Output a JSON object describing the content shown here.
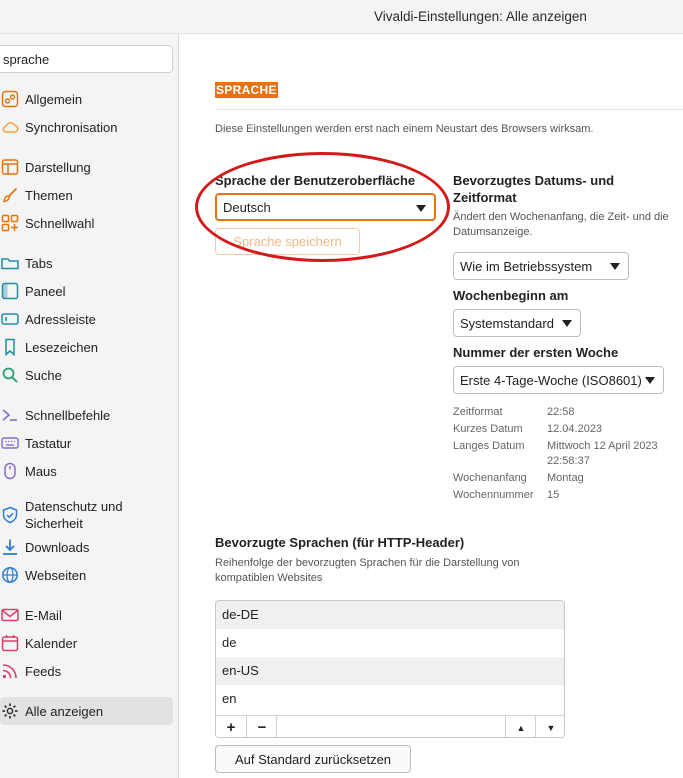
{
  "window": {
    "title": "Vivaldi-Einstellungen: Alle anzeigen"
  },
  "sidebar": {
    "search_value": "sprache",
    "items": [
      {
        "label": "Allgemein",
        "icon": "general-icon"
      },
      {
        "label": "Synchronisation",
        "icon": "cloud-sync-icon"
      },
      {
        "label": "Darstellung",
        "icon": "appearance-icon"
      },
      {
        "label": "Themen",
        "icon": "brush-icon"
      },
      {
        "label": "Schnellwahl",
        "icon": "speed-dial-icon"
      },
      {
        "label": "Tabs",
        "icon": "tabs-icon"
      },
      {
        "label": "Paneel",
        "icon": "panel-icon"
      },
      {
        "label": "Adressleiste",
        "icon": "address-bar-icon"
      },
      {
        "label": "Lesezeichen",
        "icon": "bookmark-icon"
      },
      {
        "label": "Suche",
        "icon": "search-icon"
      },
      {
        "label": "Schnellbefehle",
        "icon": "quick-commands-icon"
      },
      {
        "label": "Tastatur",
        "icon": "keyboard-icon"
      },
      {
        "label": "Maus",
        "icon": "mouse-icon"
      },
      {
        "label": "Datenschutz und Sicherheit",
        "icon": "shield-icon"
      },
      {
        "label": "Downloads",
        "icon": "download-icon"
      },
      {
        "label": "Webseiten",
        "icon": "globe-icon"
      },
      {
        "label": "E-Mail",
        "icon": "mail-icon"
      },
      {
        "label": "Kalender",
        "icon": "calendar-icon"
      },
      {
        "label": "Feeds",
        "icon": "feed-icon"
      },
      {
        "label": "Alle anzeigen",
        "icon": "gear-icon"
      }
    ]
  },
  "main": {
    "section_title": "SPRACHE",
    "restart_note": "Diese Einstellungen werden erst nach einem Neustart des Browsers wirksam.",
    "ui_language": {
      "label": "Sprache der Benutzeroberfläche",
      "selected": "Deutsch",
      "save_button": "Sprache speichern"
    },
    "date_format": {
      "label": "Bevorzugtes Datums- und Zeitformat",
      "description": "Ändert den Wochenanfang, die Zeit- und die Datumsanzeige.",
      "format_selected": "Wie im Betriebssystem",
      "week_start_label": "Wochenbeginn am",
      "week_start_selected": "Systemstandard",
      "first_week_label": "Nummer der ersten Woche",
      "first_week_selected": "Erste 4-Tage-Woche (ISO8601)"
    },
    "info": [
      {
        "key": "Zeitformat",
        "value": "22:58"
      },
      {
        "key": "Kurzes Datum",
        "value": "12.04.2023"
      },
      {
        "key": "Langes Datum",
        "value": "Mittwoch 12 April 2023",
        "value2": "22:58:37"
      },
      {
        "key": "Wochenanfang",
        "value": "Montag"
      },
      {
        "key": "Wochennummer",
        "value": "15"
      }
    ],
    "http_languages": {
      "label": "Bevorzugte Sprachen (für HTTP-Header)",
      "description": "Reihenfolge der bevorzugten Sprachen für die Darstellung von kompatiblen Websites",
      "items": [
        "de-DE",
        "de",
        "en-US",
        "en"
      ],
      "add": "+",
      "remove": "−",
      "up": "▲",
      "down": "▼",
      "reset_button": "Auf Standard zurücksetzen"
    }
  },
  "colors": {
    "accent": "#e8720c",
    "annotation": "#d41919"
  }
}
